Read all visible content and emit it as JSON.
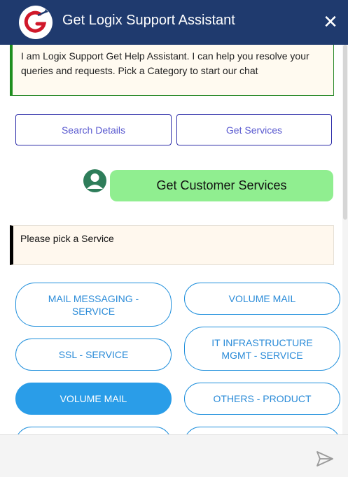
{
  "header": {
    "title": "Get Logix Support Assistant",
    "close_glyph": "✕",
    "logo_icon": "getlogix-logo-icon",
    "bg_color": "#1f3a6e"
  },
  "chat": {
    "intro": "I am Logix Support Get Help Assistant. I can help you resolve your queries and requests. Pick a Category to start our chat",
    "category_buttons": [
      "Search Details",
      "Get Services"
    ],
    "user_message": "Get Customer Services",
    "prompt": "Please pick a Service",
    "services": [
      {
        "label": "MAIL MESSAGING - SERVICE",
        "selected": false
      },
      {
        "label": "VOLUME MAIL",
        "selected": false
      },
      {
        "label": "SSL - SERVICE",
        "selected": false
      },
      {
        "label": "IT INFRASTRUCTURE MGMT - SERVICE",
        "selected": false
      },
      {
        "label": "VOLUME MAIL",
        "selected": true
      },
      {
        "label": "OTHERS - PRODUCT",
        "selected": false
      },
      {
        "label": "",
        "selected": false
      },
      {
        "label": "",
        "selected": false
      }
    ]
  },
  "footer": {
    "input_value": "",
    "input_placeholder": "",
    "send_icon": "send-icon"
  },
  "colors": {
    "accent": "#2a9de8",
    "user_bubble": "#90ee90",
    "intro_border": "#1e8e1e"
  }
}
